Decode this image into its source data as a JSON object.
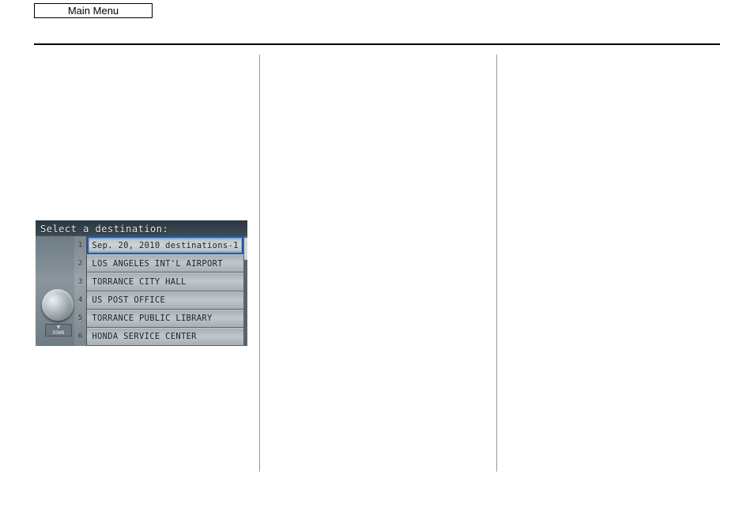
{
  "header": {
    "main_menu_label": "Main Menu"
  },
  "nav_screen": {
    "title": "Select a destination:",
    "down_label": "DOWN",
    "indices": [
      "1",
      "2",
      "3",
      "4",
      "5",
      "6"
    ],
    "items": [
      {
        "label": "Sep. 20, 2010 destinations-1",
        "selected": true
      },
      {
        "label": "LOS ANGELES INT'L AIRPORT",
        "selected": false
      },
      {
        "label": "TORRANCE CITY HALL",
        "selected": false
      },
      {
        "label": "US POST OFFICE",
        "selected": false
      },
      {
        "label": "TORRANCE PUBLIC LIBRARY",
        "selected": false
      },
      {
        "label": "HONDA SERVICE CENTER",
        "selected": false
      }
    ]
  }
}
